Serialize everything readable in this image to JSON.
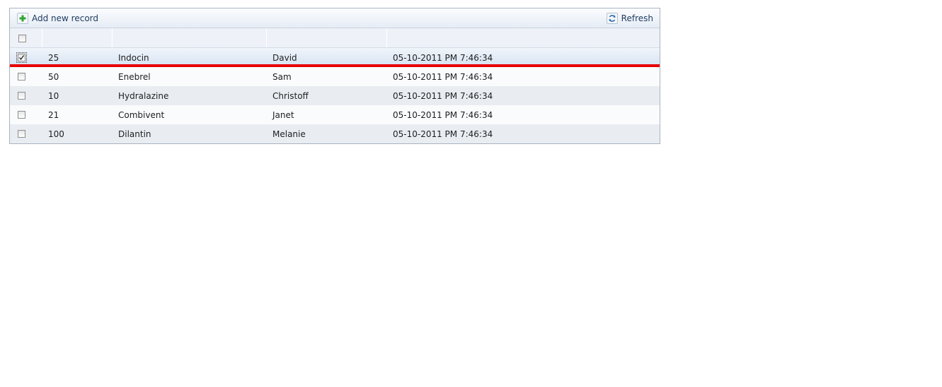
{
  "toolbar": {
    "add_label": "Add new record",
    "refresh_label": "Refresh"
  },
  "colors": {
    "drop_indicator": "#e60000",
    "selected_row": "#d6e2f1",
    "alt_row": "#e9edf2"
  },
  "rows": [
    {
      "qty": "25",
      "drug": "Indocin",
      "patient": "David",
      "date": "05-10-2011 PM 7:46:34",
      "checked": true
    },
    {
      "qty": "50",
      "drug": "Enebrel",
      "patient": "Sam",
      "date": "05-10-2011 PM 7:46:34",
      "checked": false
    },
    {
      "qty": "10",
      "drug": "Hydralazine",
      "patient": "Christoff",
      "date": "05-10-2011 PM 7:46:34",
      "checked": false
    },
    {
      "qty": "21",
      "drug": "Combivent",
      "patient": "Janet",
      "date": "05-10-2011 PM 7:46:34",
      "checked": false
    },
    {
      "qty": "100",
      "drug": "Dilantin",
      "patient": "Melanie",
      "date": "05-10-2011 PM 7:46:34",
      "checked": false
    }
  ]
}
